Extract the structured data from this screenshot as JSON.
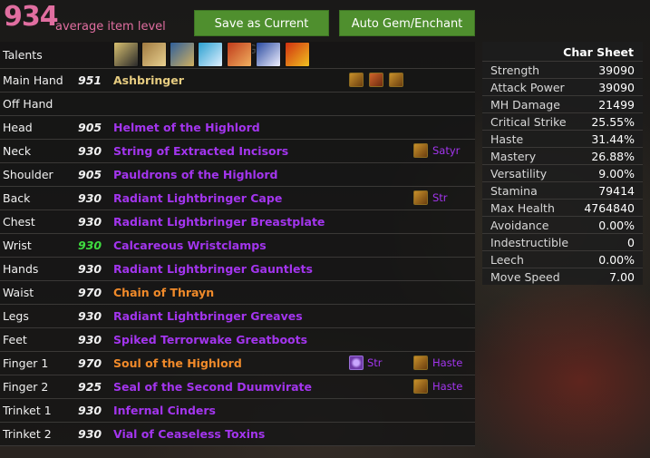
{
  "header": {
    "average_ilvl": "934",
    "average_ilvl_label": "average item level",
    "save_button": "Save as Current Gear",
    "auto_button": "Auto Gem/Enchant"
  },
  "talents_label": "Talents",
  "talent_icons": [
    "talent-1-icon",
    "talent-2-icon",
    "talent-3-icon",
    "talent-4-icon",
    "talent-5-icon",
    "talent-6-icon",
    "talent-7-icon"
  ],
  "gear": [
    {
      "slot": "Main Hand",
      "ilvl": "951",
      "item": "Ashbringer",
      "quality": "artifact",
      "relics": [
        "relic-holy-icon",
        "relic-fire-icon",
        "relic-holy-icon"
      ]
    },
    {
      "slot": "Off Hand",
      "ilvl": "",
      "item": ""
    },
    {
      "slot": "Head",
      "ilvl": "905",
      "item": "Helmet of the Highlord"
    },
    {
      "slot": "Neck",
      "ilvl": "930",
      "item": "String of Extracted Incisors",
      "enchant": "Satyr"
    },
    {
      "slot": "Shoulder",
      "ilvl": "905",
      "item": "Pauldrons of the Highlord"
    },
    {
      "slot": "Back",
      "ilvl": "930",
      "item": "Radiant Lightbringer Cape",
      "enchant": "Str"
    },
    {
      "slot": "Chest",
      "ilvl": "930",
      "item": "Radiant Lightbringer Breastplate"
    },
    {
      "slot": "Wrist",
      "ilvl": "930",
      "item": "Calcareous Wristclamps",
      "ilvl_color": "green"
    },
    {
      "slot": "Hands",
      "ilvl": "930",
      "item": "Radiant Lightbringer Gauntlets"
    },
    {
      "slot": "Waist",
      "ilvl": "970",
      "item": "Chain of Thrayn",
      "quality": "legendary"
    },
    {
      "slot": "Legs",
      "ilvl": "930",
      "item": "Radiant Lightbringer Greaves"
    },
    {
      "slot": "Feet",
      "ilvl": "930",
      "item": "Spiked Terrorwake Greatboots"
    },
    {
      "slot": "Finger 1",
      "ilvl": "970",
      "item": "Soul of the Highlord",
      "quality": "legendary",
      "gem": "Str",
      "enchant": "Haste"
    },
    {
      "slot": "Finger 2",
      "ilvl": "925",
      "item": "Seal of the Second Duumvirate",
      "enchant": "Haste"
    },
    {
      "slot": "Trinket 1",
      "ilvl": "930",
      "item": "Infernal Cinders"
    },
    {
      "slot": "Trinket 2",
      "ilvl": "930",
      "item": "Vial of Ceaseless Toxins"
    }
  ],
  "char_sheet": {
    "title": "Char Sheet",
    "stats": [
      {
        "name": "Strength",
        "value": "39090"
      },
      {
        "name": "Attack Power",
        "value": "39090"
      },
      {
        "name": "MH Damage",
        "value": "21499"
      },
      {
        "name": "Critical Strike",
        "value": "25.55%"
      },
      {
        "name": "Haste",
        "value": "31.44%"
      },
      {
        "name": "Mastery",
        "value": "26.88%"
      },
      {
        "name": "Versatility",
        "value": "9.00%"
      },
      {
        "name": "Stamina",
        "value": "79414"
      },
      {
        "name": "Max Health",
        "value": "4764840"
      },
      {
        "name": "Avoidance",
        "value": "0.00%"
      },
      {
        "name": "Indestructible",
        "value": "0"
      },
      {
        "name": "Leech",
        "value": "0.00%"
      },
      {
        "name": "Move Speed",
        "value": "7.00"
      }
    ]
  },
  "colors": {
    "epic": "#a335ee",
    "legendary": "#f08a2a",
    "artifact": "#e6cc80",
    "ilvl_highlight": "#3fdc3f",
    "average_ilvl": "#e06ea0",
    "button": "#4f8f2e"
  }
}
